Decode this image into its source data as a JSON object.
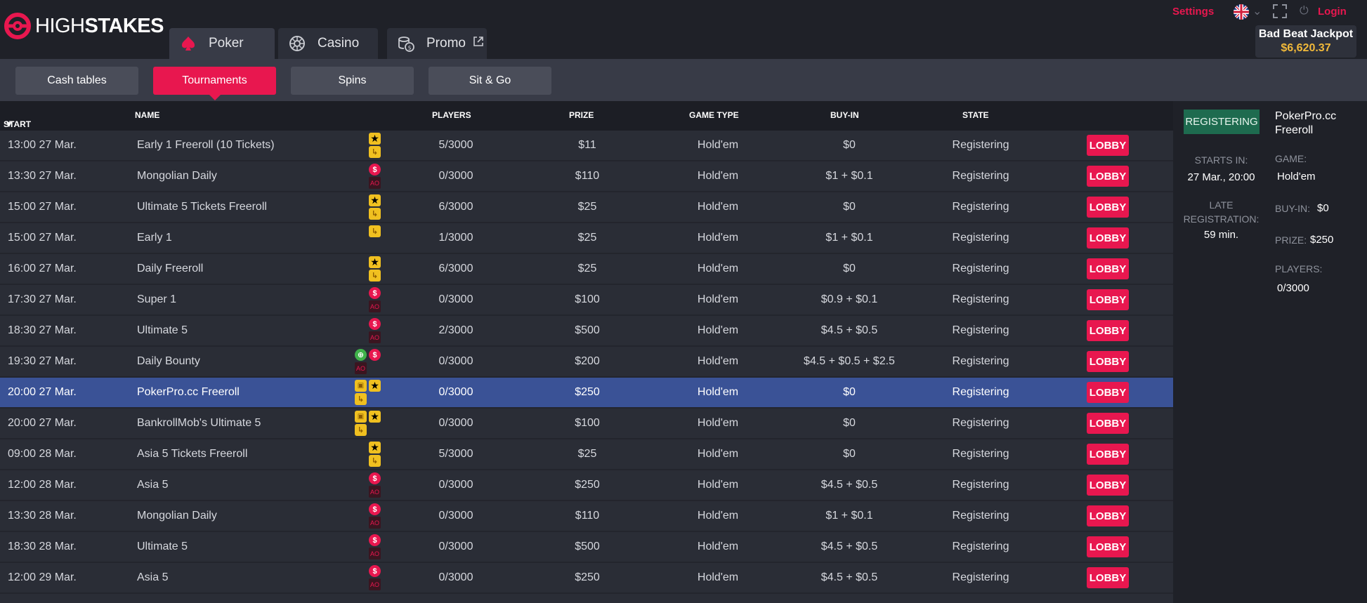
{
  "header": {
    "logo_light": "HIGH",
    "logo_bold": "STAKES",
    "tabs": [
      {
        "label": "Poker"
      },
      {
        "label": "Casino"
      },
      {
        "label": "Promo"
      }
    ],
    "settings_label": "Settings",
    "login_label": "Login",
    "jackpot_label": "Bad Beat Jackpot",
    "jackpot_value": "$6,620.37"
  },
  "subnav": [
    {
      "label": "Cash tables"
    },
    {
      "label": "Tournaments"
    },
    {
      "label": "Spins"
    },
    {
      "label": "Sit & Go"
    }
  ],
  "table": {
    "columns": [
      "START",
      "NAME",
      "PLAYERS",
      "PRIZE",
      "GAME TYPE",
      "BUY-IN",
      "STATE"
    ],
    "lobby_label": "LOBBY",
    "rows": [
      {
        "start": "13:00 27 Mar.",
        "name": "Early 1 Freeroll (10 Tickets)",
        "players": "5/3000",
        "prize": "$11",
        "game": "Hold'em",
        "buyin": "$0",
        "state": "Registering",
        "badges": [
          "star",
          "ticket"
        ]
      },
      {
        "start": "13:30 27 Mar.",
        "name": "Mongolian Daily",
        "players": "0/3000",
        "prize": "$110",
        "game": "Hold'em",
        "buyin": "$1 + $0.1",
        "state": "Registering",
        "badges": [
          "dollar",
          "ao"
        ]
      },
      {
        "start": "15:00 27 Mar.",
        "name": "Ultimate 5 Tickets Freeroll",
        "players": "6/3000",
        "prize": "$25",
        "game": "Hold'em",
        "buyin": "$0",
        "state": "Registering",
        "badges": [
          "star",
          "ticket"
        ]
      },
      {
        "start": "15:00 27 Mar.",
        "name": "Early 1",
        "players": "1/3000",
        "prize": "$25",
        "game": "Hold'em",
        "buyin": "$1 + $0.1",
        "state": "Registering",
        "badges": [
          "ticket"
        ]
      },
      {
        "start": "16:00 27 Mar.",
        "name": "Daily Freeroll",
        "players": "6/3000",
        "prize": "$25",
        "game": "Hold'em",
        "buyin": "$0",
        "state": "Registering",
        "badges": [
          "star",
          "ticket"
        ]
      },
      {
        "start": "17:30 27 Mar.",
        "name": "Super 1",
        "players": "0/3000",
        "prize": "$100",
        "game": "Hold'em",
        "buyin": "$0.9 + $0.1",
        "state": "Registering",
        "badges": [
          "dollar",
          "ao"
        ]
      },
      {
        "start": "18:30 27 Mar.",
        "name": "Ultimate 5",
        "players": "2/3000",
        "prize": "$500",
        "game": "Hold'em",
        "buyin": "$4.5 + $0.5",
        "state": "Registering",
        "badges": [
          "dollar",
          "ao"
        ]
      },
      {
        "start": "19:30 27 Mar.",
        "name": "Daily Bounty",
        "players": "0/3000",
        "prize": "$200",
        "game": "Hold'em",
        "buyin": "$4.5 + $0.5 + $2.5",
        "state": "Registering",
        "badges": [
          "bounty",
          "dollar",
          "ao"
        ]
      },
      {
        "start": "20:00 27 Mar.",
        "name": "PokerPro.cc Freeroll",
        "players": "0/3000",
        "prize": "$250",
        "game": "Hold'em",
        "buyin": "$0",
        "state": "Registering",
        "badges": [
          "lock",
          "star",
          "ticket"
        ],
        "selected": true
      },
      {
        "start": "20:00 27 Mar.",
        "name": "BankrollMob's Ultimate 5",
        "players": "0/3000",
        "prize": "$100",
        "game": "Hold'em",
        "buyin": "$0",
        "state": "Registering",
        "badges": [
          "lock",
          "star",
          "ticket"
        ]
      },
      {
        "start": "09:00 28 Mar.",
        "name": "Asia 5 Tickets Freeroll",
        "players": "5/3000",
        "prize": "$25",
        "game": "Hold'em",
        "buyin": "$0",
        "state": "Registering",
        "badges": [
          "star",
          "ticket"
        ]
      },
      {
        "start": "12:00 28 Mar.",
        "name": "Asia 5",
        "players": "0/3000",
        "prize": "$250",
        "game": "Hold'em",
        "buyin": "$4.5 + $0.5",
        "state": "Registering",
        "badges": [
          "dollar",
          "ao"
        ]
      },
      {
        "start": "13:30 28 Mar.",
        "name": "Mongolian Daily",
        "players": "0/3000",
        "prize": "$110",
        "game": "Hold'em",
        "buyin": "$1 + $0.1",
        "state": "Registering",
        "badges": [
          "dollar",
          "ao"
        ]
      },
      {
        "start": "18:30 28 Mar.",
        "name": "Ultimate 5",
        "players": "0/3000",
        "prize": "$500",
        "game": "Hold'em",
        "buyin": "$4.5 + $0.5",
        "state": "Registering",
        "badges": [
          "dollar",
          "ao"
        ]
      },
      {
        "start": "12:00 29 Mar.",
        "name": "Asia 5",
        "players": "0/3000",
        "prize": "$250",
        "game": "Hold'em",
        "buyin": "$4.5 + $0.5",
        "state": "Registering",
        "badges": [
          "dollar",
          "ao"
        ]
      }
    ]
  },
  "details": {
    "status": "REGISTERING",
    "title": "PokerPro.cc Freeroll",
    "starts_in_label": "STARTS IN:",
    "starts_in_value": "27 Mar., 20:00",
    "late_reg_label": "LATE REGISTRATION:",
    "late_reg_value": "59 min.",
    "game_label": "GAME:",
    "game_value": "Hold'em",
    "buyin_label": "BUY-IN:",
    "buyin_value": "$0",
    "prize_label": "PRIZE:",
    "prize_value": "$250",
    "players_label": "PLAYERS:",
    "players_value": "0/3000"
  },
  "colors": {
    "accent": "#e8174f",
    "selected_row": "#3a5296",
    "status_green": "#1e6b4f",
    "jackpot_gold": "#f1b93a"
  }
}
